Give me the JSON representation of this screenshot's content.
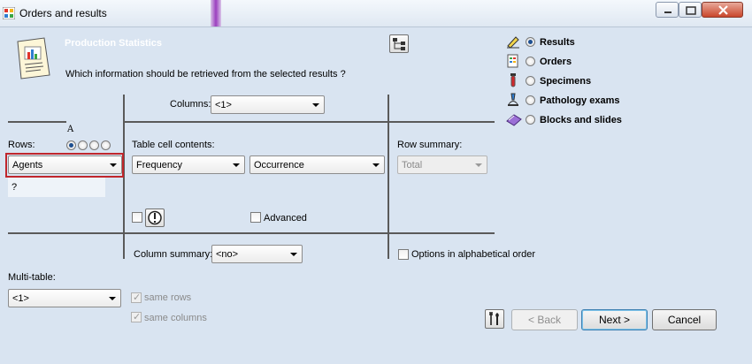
{
  "window": {
    "title": "Orders and results"
  },
  "header": {
    "section_title": "Production Statistics",
    "question": "Which information should be retrieved from the selected results ?"
  },
  "source_options": [
    {
      "label": "Results",
      "selected": true,
      "icon": "pencil-icon"
    },
    {
      "label": "Orders",
      "selected": false,
      "icon": "order-sheet-icon"
    },
    {
      "label": "Specimens",
      "selected": false,
      "icon": "test-tube-icon"
    },
    {
      "label": "Pathology exams",
      "selected": false,
      "icon": "microscope-icon"
    },
    {
      "label": "Blocks and slides",
      "selected": false,
      "icon": "slides-icon"
    }
  ],
  "columns": {
    "label": "Columns:",
    "value": "<1>"
  },
  "rows": {
    "label": "Rows:",
    "value": "Agents",
    "hint": "?",
    "font_marker": "A"
  },
  "cell_contents": {
    "label": "Table cell contents:",
    "value1": "Frequency",
    "value2": "Occurrence"
  },
  "row_summary": {
    "label": "Row summary:",
    "value": "Total"
  },
  "advanced": {
    "label": "Advanced",
    "checked": false
  },
  "column_summary": {
    "label": "Column summary:",
    "value": "<no>"
  },
  "alpha_order": {
    "label": "Options in alphabetical order",
    "checked": false
  },
  "multi_table": {
    "label": "Multi-table:",
    "value": "<1>",
    "same_rows_label": "same rows",
    "same_columns_label": "same columns"
  },
  "buttons": {
    "back": "< Back",
    "next": "Next >",
    "cancel": "Cancel"
  },
  "colors": {
    "background": "#d9e4f1",
    "highlight_border": "#c0262c",
    "radio_selected": "#1d4f91"
  }
}
